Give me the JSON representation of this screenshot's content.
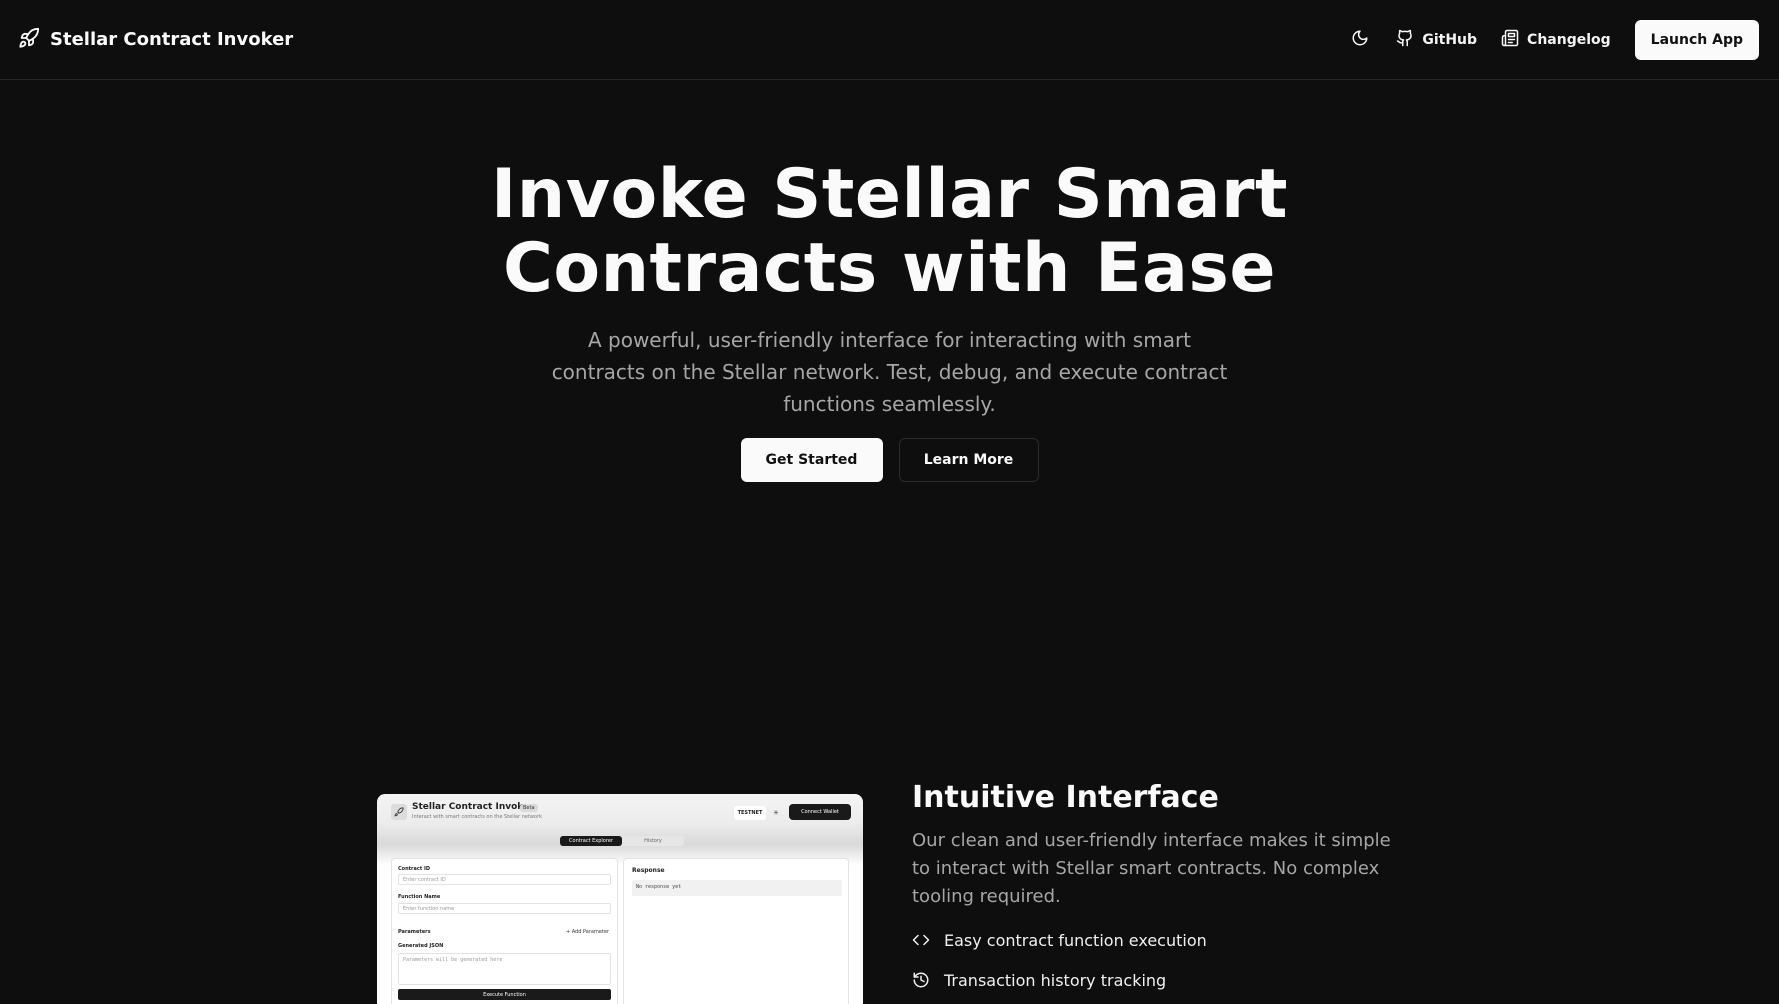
{
  "nav": {
    "brand_icon": "rocket-icon",
    "brand_name": "Stellar Contract Invoker",
    "theme_icon": "moon-icon",
    "links": [
      {
        "label": "GitHub",
        "icon": "github-icon"
      },
      {
        "label": "Changelog",
        "icon": "newspaper-icon"
      }
    ],
    "launch_label": "Launch App"
  },
  "hero": {
    "title_line1": "Invoke Stellar Smart",
    "title_line2": "Contracts with Ease",
    "subtitle": "A powerful, user-friendly interface for interacting with smart contracts on the Stellar network. Test, debug, and execute contract functions seamlessly.",
    "primary_cta": "Get Started",
    "secondary_cta": "Learn More"
  },
  "preview": {
    "title": "Stellar Contract Invoker",
    "badge": "Beta",
    "description": "Interact with smart contracts on the Stellar network",
    "network": "TESTNET",
    "wallet_button": "Connect Wallet",
    "tabs": [
      "Contract Explorer",
      "History"
    ],
    "contract_id_label": "Contract ID",
    "contract_id_placeholder": "Enter contract ID",
    "function_label": "Function Name",
    "function_placeholder": "Enter function name",
    "params_label": "Parameters",
    "add_param": "+ Add Parameter",
    "json_label": "Generated JSON",
    "json_placeholder": "Parameters will be generated here",
    "execute": "Execute Function",
    "response_label": "Response",
    "response_value": "No response yet"
  },
  "feature": {
    "title": "Intuitive Interface",
    "description": "Our clean and user-friendly interface makes it simple to interact with Stellar smart contracts. No complex tooling required.",
    "items": [
      {
        "label": "Easy contract function execution",
        "icon": "code-icon"
      },
      {
        "label": "Transaction history tracking",
        "icon": "history-icon"
      }
    ]
  },
  "colors": {
    "background": "#0e0e0e",
    "foreground": "#fafafa",
    "muted": "#a6a6a6",
    "border": "#262626"
  }
}
